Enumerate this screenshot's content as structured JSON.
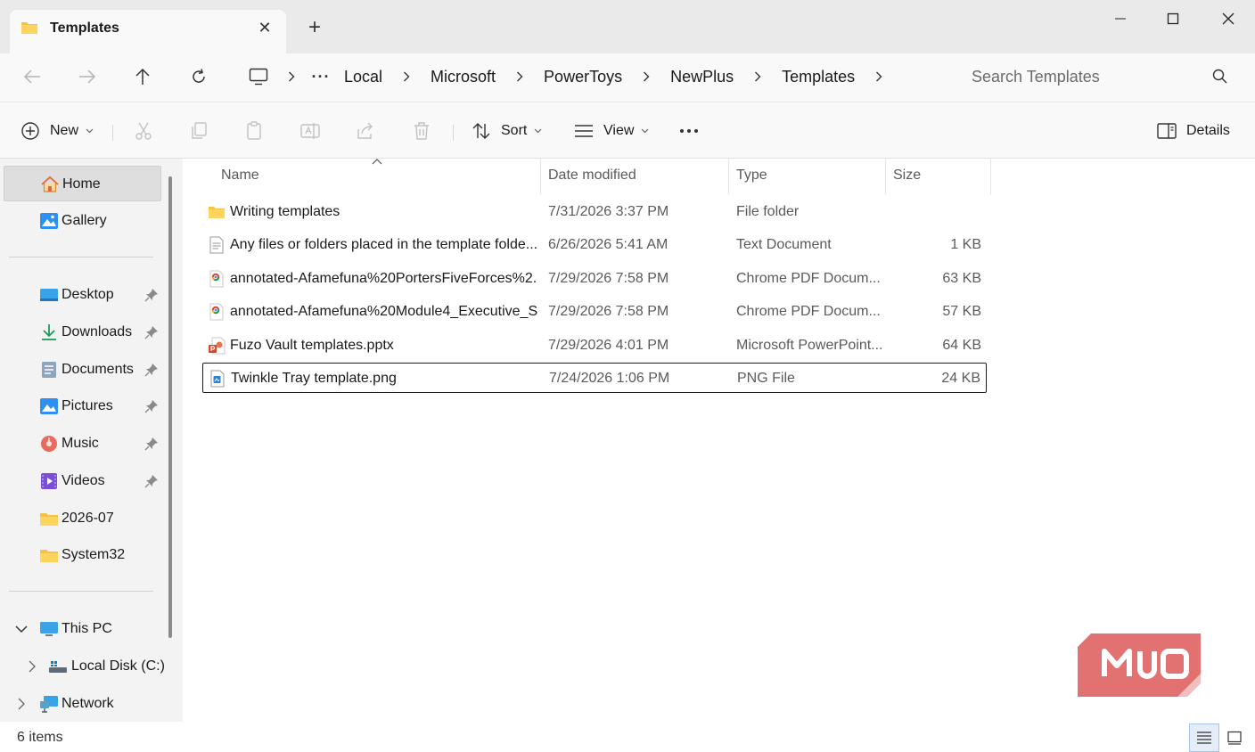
{
  "window": {
    "tab_title": "Templates",
    "tab_close_icon": "close-icon",
    "new_tab_icon": "plus-icon"
  },
  "address": {
    "ellipsis": "···",
    "crumbs": [
      "Local",
      "Microsoft",
      "PowerToys",
      "NewPlus",
      "Templates"
    ],
    "search_placeholder": "Search Templates"
  },
  "toolbar": {
    "new_label": "New",
    "sort_label": "Sort",
    "view_label": "View",
    "details_label": "Details"
  },
  "sidebar": {
    "quick": [
      {
        "label": "Home",
        "icon": "home-icon",
        "selected": true
      },
      {
        "label": "Gallery",
        "icon": "gallery-icon"
      }
    ],
    "pinned": [
      {
        "label": "Desktop",
        "icon": "desktop-icon"
      },
      {
        "label": "Downloads",
        "icon": "download-icon"
      },
      {
        "label": "Documents",
        "icon": "documents-icon"
      },
      {
        "label": "Pictures",
        "icon": "pictures-icon"
      },
      {
        "label": "Music",
        "icon": "music-icon"
      },
      {
        "label": "Videos",
        "icon": "videos-icon"
      },
      {
        "label": "2026-07",
        "icon": "folder-icon"
      },
      {
        "label": "System32",
        "icon": "folder-icon"
      }
    ],
    "tree": [
      {
        "label": "This PC",
        "icon": "pc-icon"
      },
      {
        "label": "Local Disk (C:)",
        "icon": "drive-icon"
      },
      {
        "label": "Network",
        "icon": "network-icon"
      }
    ]
  },
  "columns": {
    "name": "Name",
    "date": "Date modified",
    "type": "Type",
    "size": "Size"
  },
  "files": [
    {
      "name": "Writing templates",
      "date": "7/31/2026 3:37 PM",
      "type": "File folder",
      "size": "",
      "icon": "folder-icon"
    },
    {
      "name": "Any files or folders placed in the template folde...",
      "date": "6/26/2026 5:41 AM",
      "type": "Text Document",
      "size": "1 KB",
      "icon": "text-file-icon"
    },
    {
      "name": "annotated-Afamefuna%20PortersFiveForces%2...",
      "date": "7/29/2026 7:58 PM",
      "type": "Chrome PDF Docum...",
      "size": "63 KB",
      "icon": "chrome-pdf-icon"
    },
    {
      "name": "annotated-Afamefuna%20Module4_Executive_S...",
      "date": "7/29/2026 7:58 PM",
      "type": "Chrome PDF Docum...",
      "size": "57 KB",
      "icon": "chrome-pdf-icon"
    },
    {
      "name": "Fuzo Vault templates.pptx",
      "date": "7/29/2026 4:01 PM",
      "type": "Microsoft PowerPoint...",
      "size": "64 KB",
      "icon": "powerpoint-icon"
    },
    {
      "name": "Twinkle Tray template.png",
      "date": "7/24/2026 1:06 PM",
      "type": "PNG File",
      "size": "24 KB",
      "icon": "image-file-icon",
      "selected": true
    }
  ],
  "status": {
    "item_count": "6 items"
  },
  "watermark": {
    "text": "MUO"
  },
  "colors": {
    "folder": "#f5c242",
    "accent": "#0067c0",
    "watermark": "#e06666"
  }
}
